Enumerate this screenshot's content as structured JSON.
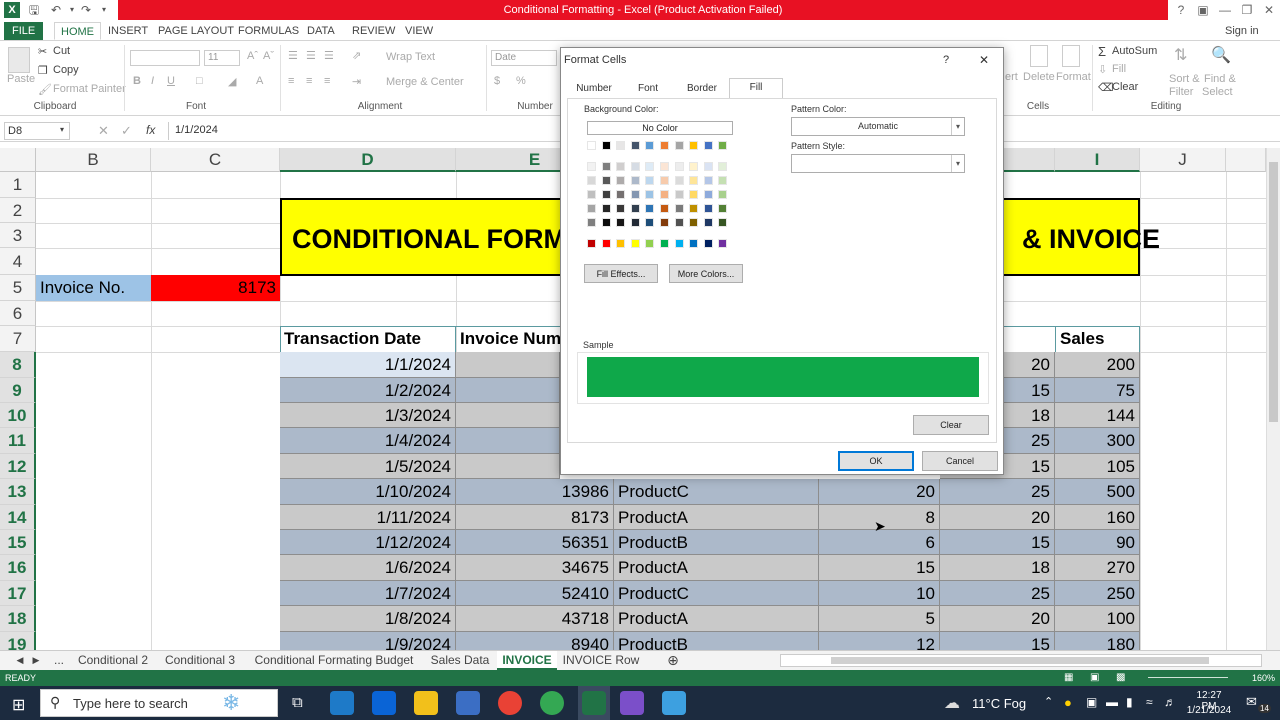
{
  "window": {
    "title": "Conditional Formatting  -  Excel (Product Activation Failed)",
    "account": "Sign in"
  },
  "ribbon_tabs": [
    "FILE",
    "HOME",
    "INSERT",
    "PAGE LAYOUT",
    "FORMULAS",
    "DATA",
    "REVIEW",
    "VIEW"
  ],
  "ribbon": {
    "clipboard": {
      "paste": "Paste",
      "cut": "Cut",
      "copy": "Copy",
      "format_painter": "Format Painter",
      "label": "Clipboard"
    },
    "font": {
      "size": "11",
      "label": "Font",
      "bold": "B",
      "italic": "I",
      "underline": "U"
    },
    "alignment": {
      "wrap_text": "Wrap Text",
      "merge": "Merge & Center",
      "label": "Alignment"
    },
    "number": {
      "format": "Date",
      "label": "Number"
    },
    "cells": {
      "insert": "ert",
      "delete": "Delete",
      "format": "Format",
      "label": "Cells"
    },
    "editing": {
      "autosum": "AutoSum",
      "fill": "Fill",
      "clear": "Clear",
      "sort": "Sort &",
      "filter": "Filter",
      "find": "Find &",
      "select": "Select",
      "label": "Editing"
    }
  },
  "formula_bar": {
    "name_box": "D8",
    "value": "1/1/2024",
    "fx": "fx"
  },
  "columns": [
    "B",
    "C",
    "D",
    "E",
    "I",
    "J"
  ],
  "rows": [
    "1",
    "2",
    "3",
    "4",
    "5",
    "6",
    "7",
    "8",
    "9",
    "10",
    "11",
    "12",
    "13",
    "14",
    "15",
    "16",
    "17",
    "18",
    "19"
  ],
  "sheet": {
    "banner_left": "CONDITIONAL FORM",
    "banner_right": "& INVOICE",
    "invoice_label": "Invoice No.",
    "invoice_value": "8173",
    "headers": {
      "date": "Transaction Date",
      "invoice": "Invoice Num",
      "sales": "Sales"
    },
    "upper_rows": [
      {
        "date": "1/1/2024",
        "h": "20",
        "sales": "200"
      },
      {
        "date": "1/2/2024",
        "h": "15",
        "sales": "75"
      },
      {
        "date": "1/3/2024",
        "h": "18",
        "sales": "144"
      },
      {
        "date": "1/4/2024",
        "h": "25",
        "sales": "300"
      },
      {
        "date": "1/5/2024",
        "h": "15",
        "sales": "105"
      }
    ],
    "lower_rows": [
      {
        "date": "1/10/2024",
        "invoice": "13986",
        "product": "ProductC",
        "g": "20",
        "h": "25",
        "sales": "500"
      },
      {
        "date": "1/11/2024",
        "invoice": "8173",
        "product": "ProductA",
        "g": "8",
        "h": "20",
        "sales": "160"
      },
      {
        "date": "1/12/2024",
        "invoice": "56351",
        "product": "ProductB",
        "g": "6",
        "h": "15",
        "sales": "90"
      },
      {
        "date": "1/6/2024",
        "invoice": "34675",
        "product": "ProductA",
        "g": "15",
        "h": "18",
        "sales": "270"
      },
      {
        "date": "1/7/2024",
        "invoice": "52410",
        "product": "ProductC",
        "g": "10",
        "h": "25",
        "sales": "250"
      },
      {
        "date": "1/8/2024",
        "invoice": "43718",
        "product": "ProductA",
        "g": "5",
        "h": "20",
        "sales": "100"
      },
      {
        "date": "1/9/2024",
        "invoice": "8940",
        "product": "ProductB",
        "g": "12",
        "h": "15",
        "sales": "180"
      }
    ]
  },
  "dialog": {
    "title": "Format Cells",
    "help": "?",
    "close": "✕",
    "tabs": [
      "Number",
      "Font",
      "Border",
      "Fill"
    ],
    "active_tab": "Fill",
    "background_color_label": "Background Color:",
    "no_color": "No Color",
    "fill_effects": "Fill Effects...",
    "more_colors": "More Colors...",
    "pattern_color_label": "Pattern Color:",
    "pattern_color_value": "Automatic",
    "pattern_style_label": "Pattern Style:",
    "sample_label": "Sample",
    "sample_color": "#0fa84a",
    "clear": "Clear",
    "ok": "OK",
    "cancel": "Cancel"
  },
  "sheet_tabs": [
    "...",
    "Conditional 2",
    "Conditional 3",
    "Conditional Formating Budget",
    "Sales Data",
    "INVOICE",
    "INVOICE Row"
  ],
  "active_sheet": "INVOICE",
  "status": {
    "mode": "READY",
    "zoom": "160%"
  },
  "taskbar": {
    "search_placeholder": "Type here to search",
    "weather": "11°C  Fog",
    "time": "12:27 PM",
    "date": "1/21/2024",
    "notifications": "14"
  },
  "colors": {
    "excel_green": "#217346",
    "title_red": "#e81123",
    "banner_yellow": "#ffff00",
    "invoice_red": "#ff0000",
    "label_blue": "#9dc3e6",
    "row_gray": "#c9c9c9",
    "row_blue": "#acb9ca"
  }
}
